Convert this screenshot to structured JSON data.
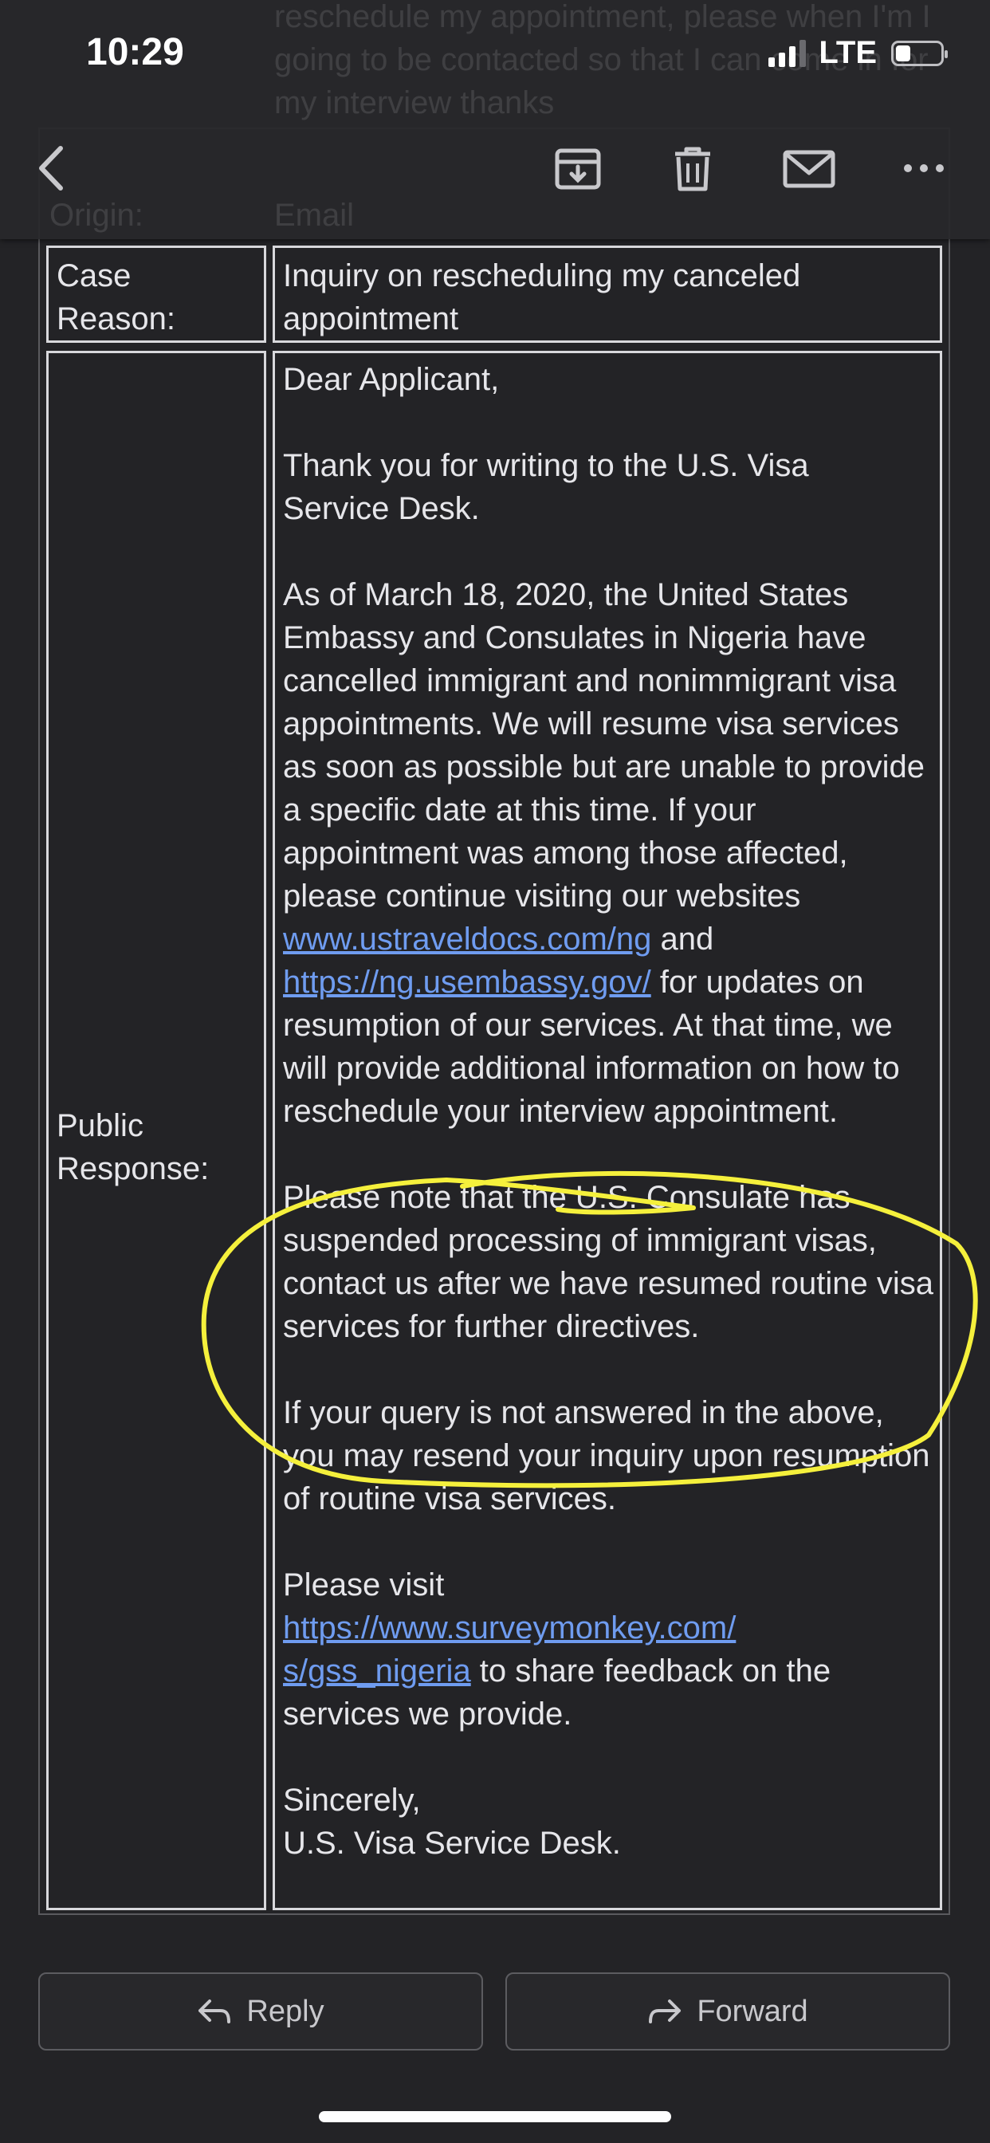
{
  "status_bar": {
    "time": "10:29",
    "network": "LTE"
  },
  "header": {
    "ghost_text": "reschedule my appointment, please when I'm I going to be contacted so that I can come in for my interview thanks",
    "ghost_origin_label": "Origin:",
    "ghost_origin_value": "Email",
    "icons": [
      "back-icon",
      "archive-icon",
      "trash-icon",
      "mail-icon",
      "more-icon"
    ]
  },
  "case": {
    "reason_label_line1": "Case",
    "reason_label_line2": "Reason:",
    "reason_value": "Inquiry on rescheduling my canceled appointment",
    "response_label_line1": "Public",
    "response_label_line2": "Response:"
  },
  "response": {
    "greeting": "Dear Applicant,",
    "thanks": "Thank you for writing to the U.S. Visa Service Desk.",
    "p1_before": "As of March 18, 2020, the United States Embassy and Consulates in Nigeria have cancelled immigrant and nonimmigrant visa appointments. We will resume visa services as soon as possible but are unable to provide a specific date at this time. If your appointment was among those affected, please continue visiting our websites ",
    "link1": "www.ustraveldocs.com/ng",
    "p1_mid": " and ",
    "link2": "https://ng.usembassy.gov/",
    "p1_after": " for updates on resumption of our services. At that time, we will provide additional information on how to reschedule your interview appointment.",
    "p2": "Please note that the U.S. Consulate has suspended processing of immigrant visas, contact us after we have resumed routine visa services for further directives.",
    "p3": "If your query is not answered in the above, you may resend your inquiry upon resumption of routine visa services.",
    "p4_before": "Please visit",
    "link3_line1": "https://www.surveymonkey.com/",
    "link3_line2": "s/gss_nigeria",
    "p4_after": " to share feedback on the services we provide.",
    "closing": "Sincerely,",
    "signature": "U.S. Visa Service Desk."
  },
  "actions": {
    "reply": "Reply",
    "forward": "Forward"
  },
  "colors": {
    "background": "#232326",
    "link": "#6f9cf0",
    "highlight": "#f5f03c"
  }
}
